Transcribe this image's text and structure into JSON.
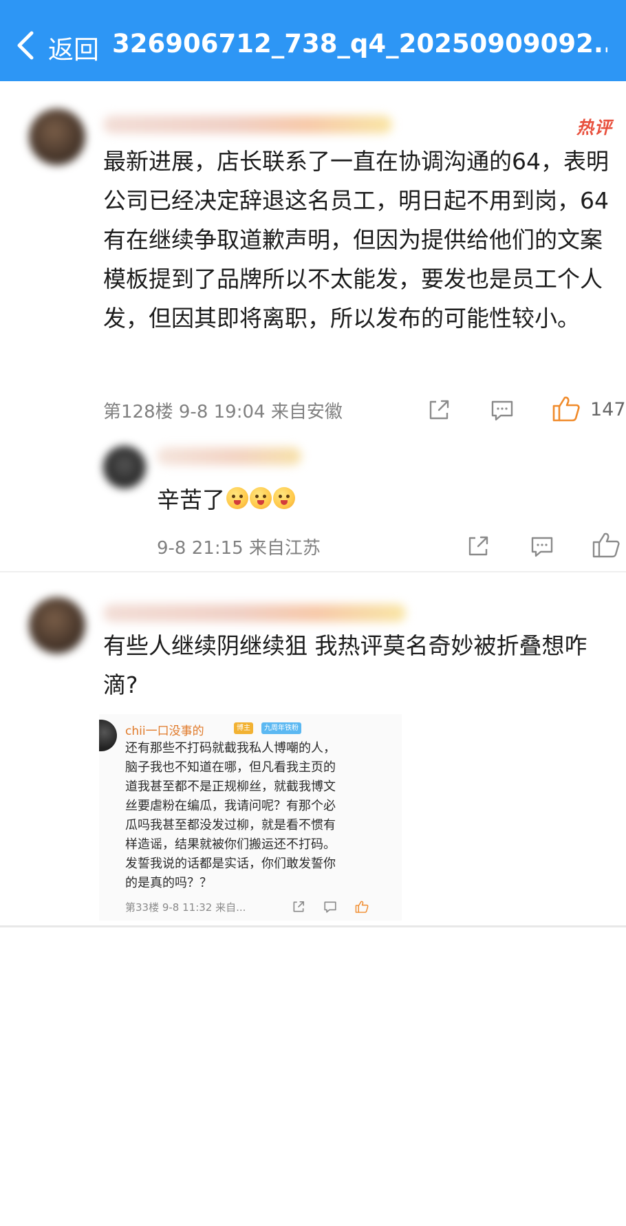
{
  "nav": {
    "back_label": "返回",
    "title": "326906712_738_q4_20250909092..."
  },
  "comments": [
    {
      "hot_badge": "热评",
      "text": "最新进展，店长联系了一直在协调沟通的64，表明公司已经决定辞退这名员工，明日起不用到岗，64有在继续争取道歉声明，但因为提供给他们的文案模板提到了品牌所以不太能发，要发也是员工个人发，但因其即将离职，所以发布的可能性较小。",
      "meta": "第128楼  9-8 19:04  来自安徽",
      "likes": "147",
      "reply": {
        "text": "辛苦了",
        "meta": "9-8 21:15  来自江苏"
      }
    },
    {
      "text": "有些人继续阴继续狙 我热评莫名奇妙被折叠想咋滴?",
      "embed": {
        "name": "chii一口没事的",
        "badge_1": "博主",
        "badge_2": "九周年铁粉",
        "lines": [
          "还有那些不打码就截我私人博嘲的人，",
          "脑子我也不知道在哪，但凡看我主页的",
          "道我甚至都不是正规柳丝，就截我博文",
          "丝要虐粉在编瓜，我请问呢？有那个必",
          "瓜吗我甚至都没发过柳，就是看不惯有",
          "样造谣，结果就被你们搬运还不打码。",
          "发誓我说的话都是实话，你们敢发誓你",
          "的是真的吗？？"
        ],
        "meta": "第33楼  9-8 11:32  来自..."
      }
    }
  ],
  "colors": {
    "nav_bg": "#2d96f5",
    "hot_badge": "#e8503d",
    "like_active": "#f08a2a"
  }
}
